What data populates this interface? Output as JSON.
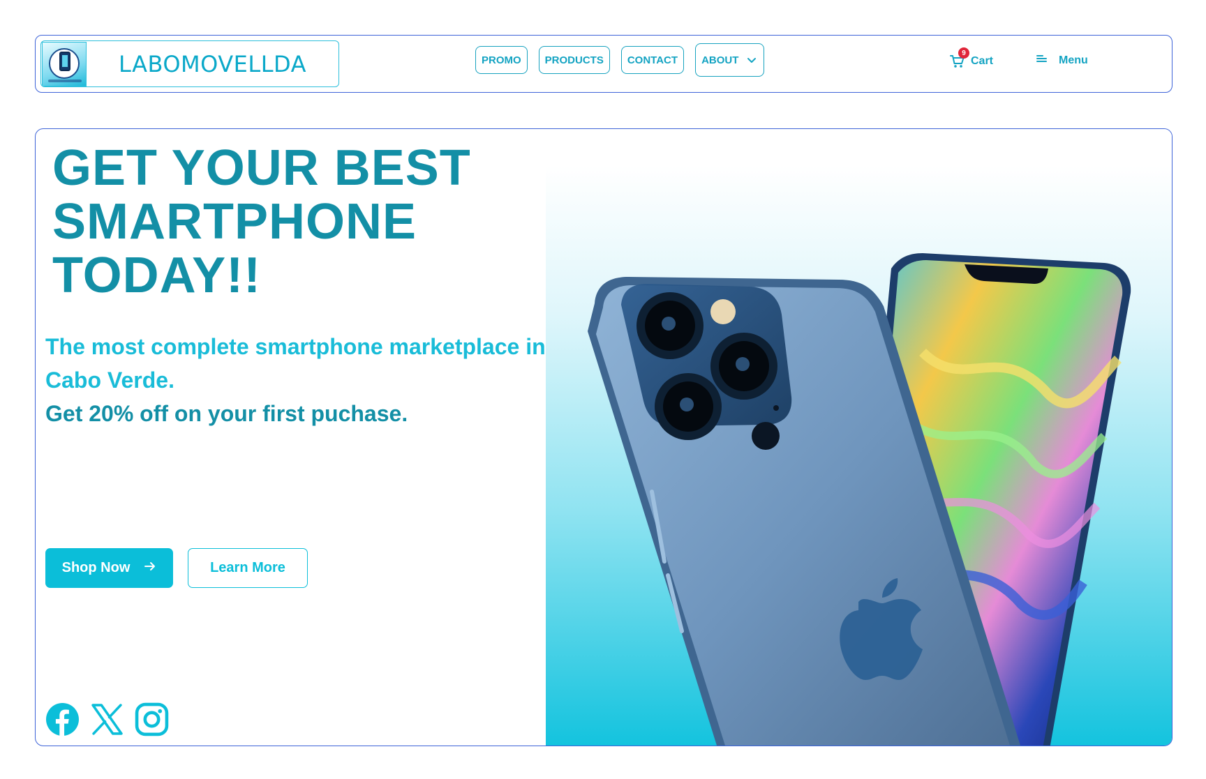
{
  "header": {
    "brand_name": "LABOMOVELLDA",
    "nav": [
      {
        "label": "PROMO"
      },
      {
        "label": "PRODUCTS"
      },
      {
        "label": "CONTACT"
      },
      {
        "label": "ABOUT"
      }
    ],
    "cart": {
      "label": "Cart",
      "count": "9"
    },
    "menu": {
      "label": "Menu"
    }
  },
  "hero": {
    "headline": "GET YOUR BEST SMARTPHONE TODAY!!",
    "subtitle_line1": "The most complete smartphone marketplace in Cabo Verde.",
    "subtitle_line2": "Get 20% off on your first puchase.",
    "primary_cta": "Shop Now",
    "secondary_cta": "Learn More",
    "socials": [
      "facebook-icon",
      "x-icon",
      "instagram-icon"
    ]
  },
  "colors": {
    "accent": "#0bbed9",
    "heading": "#138fa6",
    "border": "#3d63d8",
    "badge": "#e0263a"
  }
}
